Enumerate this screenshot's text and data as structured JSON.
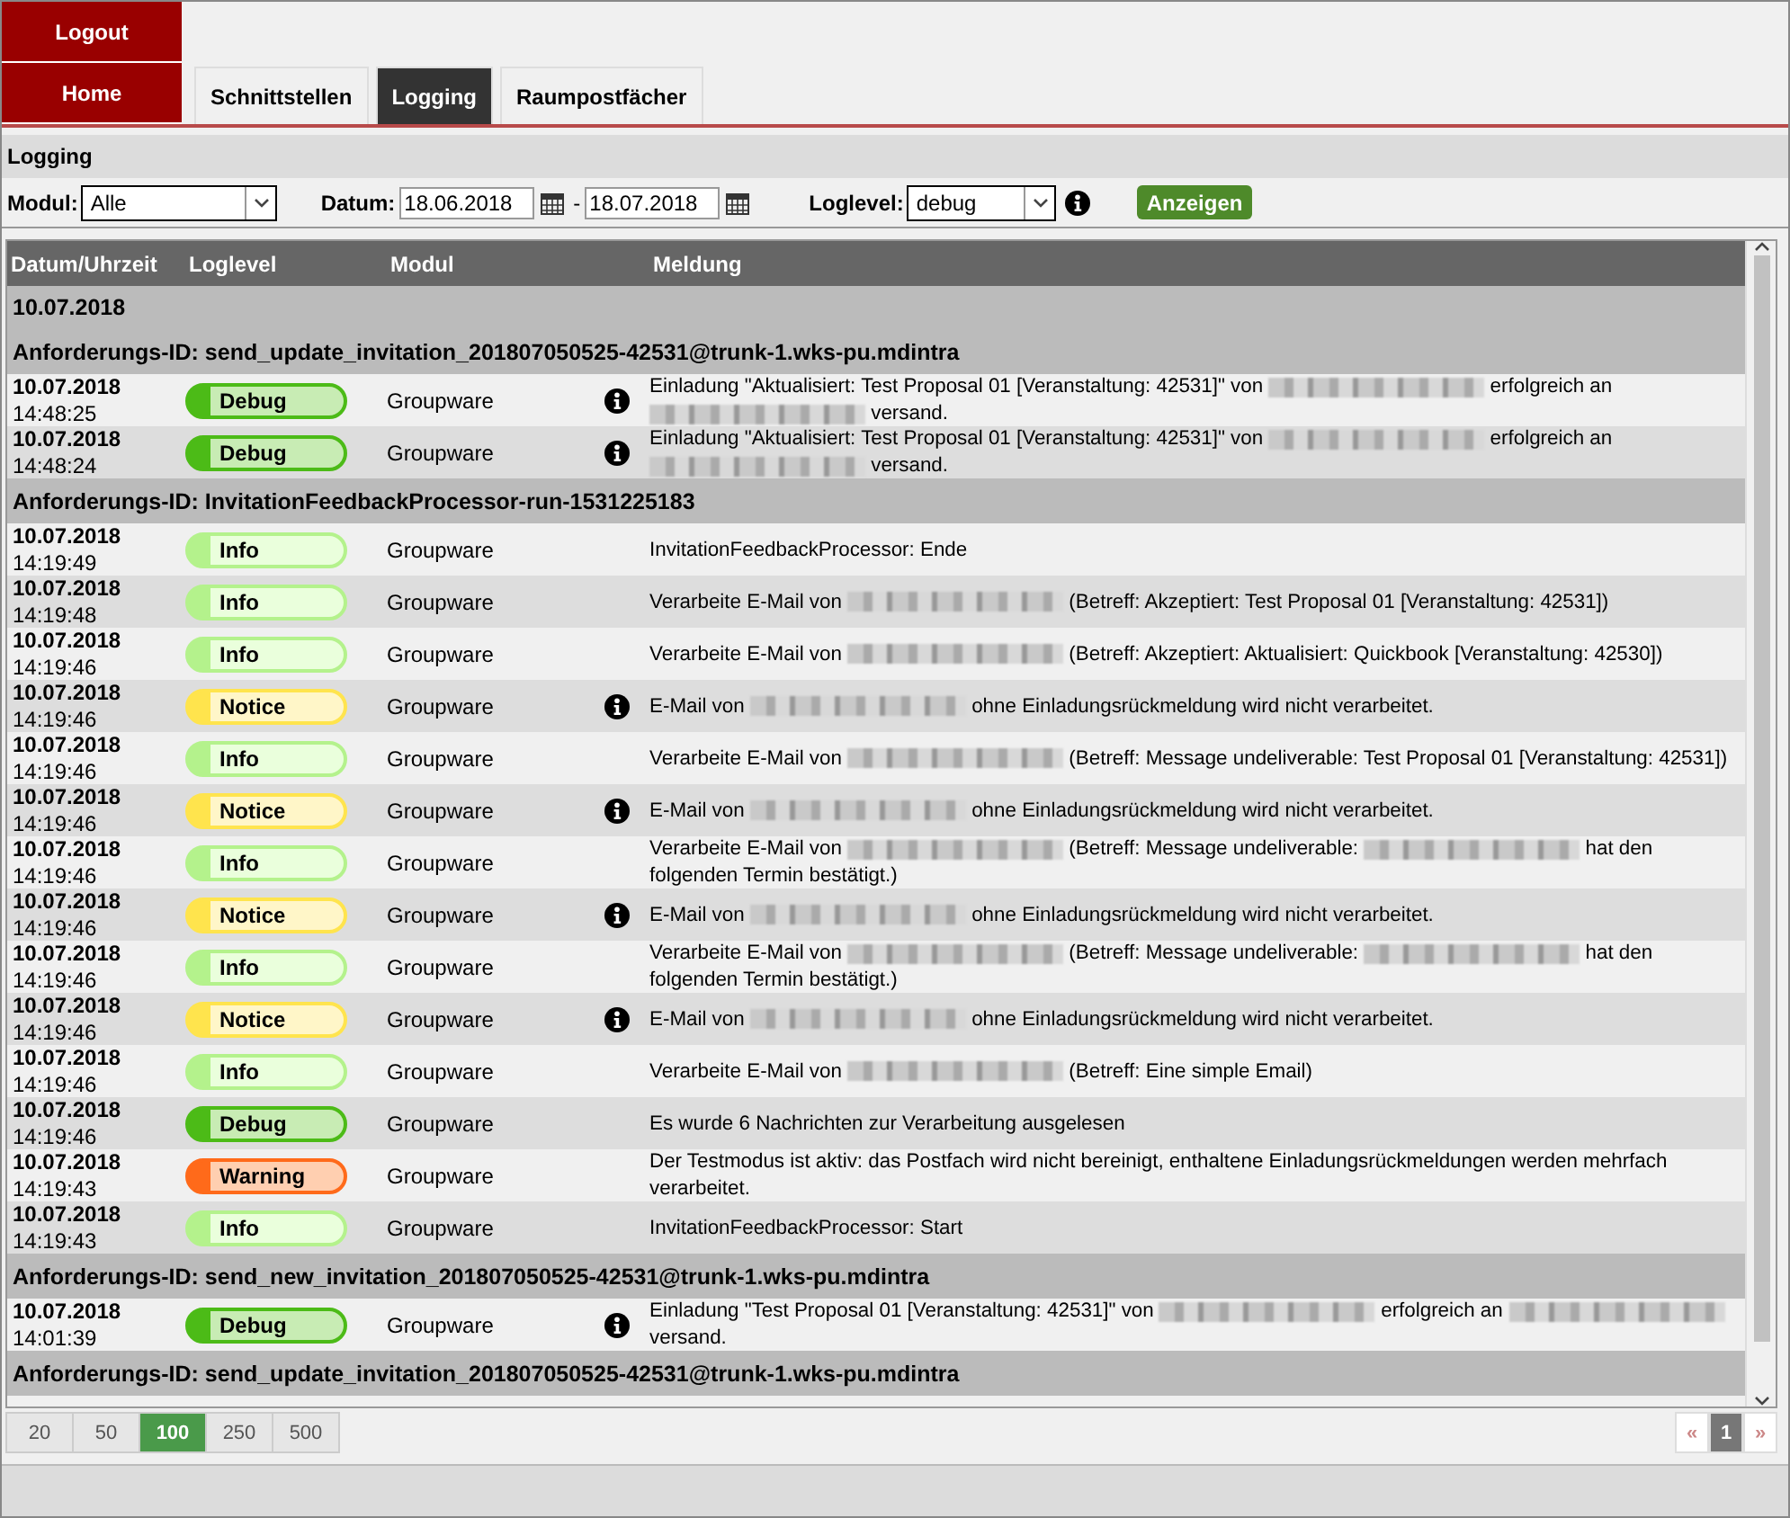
{
  "nav": {
    "logout": "Logout",
    "home": "Home",
    "tabs": [
      {
        "label": "Schnittstellen",
        "selected": false
      },
      {
        "label": "Logging",
        "selected": true
      },
      {
        "label": "Raumpostfächer",
        "selected": false
      }
    ]
  },
  "section_title": "Logging",
  "filter": {
    "module_label": "Modul:",
    "module_value": "Alle",
    "date_label": "Datum:",
    "date_from": "18.06.2018",
    "date_sep": "-",
    "date_to": "18.07.2018",
    "level_label": "Loglevel:",
    "level_value": "debug",
    "submit": "Anzeigen"
  },
  "table": {
    "columns": [
      "Datum/Uhrzeit",
      "Loglevel",
      "Modul",
      "Meldung"
    ],
    "rows": [
      {
        "kind": "date",
        "text": "10.07.2018"
      },
      {
        "kind": "request",
        "text": "Anforderungs-ID: send_update_invitation_201807050525-42531@trunk-1.wks-pu.mdintra"
      },
      {
        "kind": "log",
        "date": "10.07.2018",
        "time": "14:48:25",
        "level": {
          "kind": "debug",
          "label": "Debug"
        },
        "module": "Groupware",
        "info": true,
        "message": [
          {
            "kind": "text",
            "text": "Einladung \"Aktualisiert: Test Proposal 01 [Veranstaltung: 42531]\" von "
          },
          {
            "kind": "redacted"
          },
          {
            "kind": "text",
            "text": " erfolgreich an "
          },
          {
            "kind": "redacted"
          },
          {
            "kind": "text",
            "text": " versand."
          }
        ]
      },
      {
        "kind": "log",
        "date": "10.07.2018",
        "time": "14:48:24",
        "level": {
          "kind": "debug",
          "label": "Debug"
        },
        "module": "Groupware",
        "info": true,
        "message": [
          {
            "kind": "text",
            "text": "Einladung \"Aktualisiert: Test Proposal 01 [Veranstaltung: 42531]\" von "
          },
          {
            "kind": "redacted"
          },
          {
            "kind": "text",
            "text": " erfolgreich an "
          },
          {
            "kind": "redacted"
          },
          {
            "kind": "text",
            "text": " versand."
          }
        ]
      },
      {
        "kind": "request",
        "text": "Anforderungs-ID: InvitationFeedbackProcessor-run-1531225183"
      },
      {
        "kind": "log",
        "date": "10.07.2018",
        "time": "14:19:49",
        "level": {
          "kind": "info",
          "label": "Info"
        },
        "module": "Groupware",
        "info": false,
        "message": [
          {
            "kind": "text",
            "text": "InvitationFeedbackProcessor: Ende"
          }
        ]
      },
      {
        "kind": "log",
        "date": "10.07.2018",
        "time": "14:19:48",
        "level": {
          "kind": "info",
          "label": "Info"
        },
        "module": "Groupware",
        "info": false,
        "message": [
          {
            "kind": "text",
            "text": "Verarbeite E-Mail von "
          },
          {
            "kind": "redacted"
          },
          {
            "kind": "text",
            "text": " (Betreff: Akzeptiert: Test Proposal 01 [Veranstaltung: 42531])"
          }
        ]
      },
      {
        "kind": "log",
        "date": "10.07.2018",
        "time": "14:19:46",
        "level": {
          "kind": "info",
          "label": "Info"
        },
        "module": "Groupware",
        "info": false,
        "message": [
          {
            "kind": "text",
            "text": "Verarbeite E-Mail von "
          },
          {
            "kind": "redacted"
          },
          {
            "kind": "text",
            "text": " (Betreff: Akzeptiert: Aktualisiert: Quickbook [Veranstaltung: 42530])"
          }
        ]
      },
      {
        "kind": "log",
        "date": "10.07.2018",
        "time": "14:19:46",
        "level": {
          "kind": "notice",
          "label": "Notice"
        },
        "module": "Groupware",
        "info": true,
        "message": [
          {
            "kind": "text",
            "text": "E-Mail von "
          },
          {
            "kind": "redacted"
          },
          {
            "kind": "text",
            "text": " ohne Einladungsrückmeldung wird nicht verarbeitet."
          }
        ]
      },
      {
        "kind": "log",
        "date": "10.07.2018",
        "time": "14:19:46",
        "level": {
          "kind": "info",
          "label": "Info"
        },
        "module": "Groupware",
        "info": false,
        "message": [
          {
            "kind": "text",
            "text": "Verarbeite E-Mail von "
          },
          {
            "kind": "redacted"
          },
          {
            "kind": "text",
            "text": " (Betreff: Message undeliverable: Test Proposal 01 [Veranstaltung: 42531])"
          }
        ]
      },
      {
        "kind": "log",
        "date": "10.07.2018",
        "time": "14:19:46",
        "level": {
          "kind": "notice",
          "label": "Notice"
        },
        "module": "Groupware",
        "info": true,
        "message": [
          {
            "kind": "text",
            "text": "E-Mail von "
          },
          {
            "kind": "redacted"
          },
          {
            "kind": "text",
            "text": " ohne Einladungsrückmeldung wird nicht verarbeitet."
          }
        ]
      },
      {
        "kind": "log",
        "date": "10.07.2018",
        "time": "14:19:46",
        "level": {
          "kind": "info",
          "label": "Info"
        },
        "module": "Groupware",
        "info": false,
        "message": [
          {
            "kind": "text",
            "text": "Verarbeite E-Mail von "
          },
          {
            "kind": "redacted"
          },
          {
            "kind": "text",
            "text": " (Betreff: Message undeliverable: "
          },
          {
            "kind": "redacted"
          },
          {
            "kind": "text",
            "text": " hat den folgenden Termin bestätigt.)"
          }
        ]
      },
      {
        "kind": "log",
        "date": "10.07.2018",
        "time": "14:19:46",
        "level": {
          "kind": "notice",
          "label": "Notice"
        },
        "module": "Groupware",
        "info": true,
        "message": [
          {
            "kind": "text",
            "text": "E-Mail von "
          },
          {
            "kind": "redacted"
          },
          {
            "kind": "text",
            "text": " ohne Einladungsrückmeldung wird nicht verarbeitet."
          }
        ]
      },
      {
        "kind": "log",
        "date": "10.07.2018",
        "time": "14:19:46",
        "level": {
          "kind": "info",
          "label": "Info"
        },
        "module": "Groupware",
        "info": false,
        "message": [
          {
            "kind": "text",
            "text": "Verarbeite E-Mail von "
          },
          {
            "kind": "redacted"
          },
          {
            "kind": "text",
            "text": " (Betreff: Message undeliverable: "
          },
          {
            "kind": "redacted"
          },
          {
            "kind": "text",
            "text": " hat den folgenden Termin bestätigt.)"
          }
        ]
      },
      {
        "kind": "log",
        "date": "10.07.2018",
        "time": "14:19:46",
        "level": {
          "kind": "notice",
          "label": "Notice"
        },
        "module": "Groupware",
        "info": true,
        "message": [
          {
            "kind": "text",
            "text": "E-Mail von "
          },
          {
            "kind": "redacted"
          },
          {
            "kind": "text",
            "text": " ohne Einladungsrückmeldung wird nicht verarbeitet."
          }
        ]
      },
      {
        "kind": "log",
        "date": "10.07.2018",
        "time": "14:19:46",
        "level": {
          "kind": "info",
          "label": "Info"
        },
        "module": "Groupware",
        "info": false,
        "message": [
          {
            "kind": "text",
            "text": "Verarbeite E-Mail von "
          },
          {
            "kind": "redacted"
          },
          {
            "kind": "text",
            "text": " (Betreff: Eine simple Email)"
          }
        ]
      },
      {
        "kind": "log",
        "date": "10.07.2018",
        "time": "14:19:46",
        "level": {
          "kind": "debug",
          "label": "Debug"
        },
        "module": "Groupware",
        "info": false,
        "message": [
          {
            "kind": "text",
            "text": "Es wurde 6 Nachrichten zur Verarbeitung ausgelesen"
          }
        ]
      },
      {
        "kind": "log",
        "date": "10.07.2018",
        "time": "14:19:43",
        "level": {
          "kind": "warning",
          "label": "Warning"
        },
        "module": "Groupware",
        "info": false,
        "message": [
          {
            "kind": "text",
            "text": "Der Testmodus ist aktiv: das Postfach wird nicht bereinigt, enthaltene Einladungsrückmeldungen werden mehrfach verarbeitet."
          }
        ]
      },
      {
        "kind": "log",
        "date": "10.07.2018",
        "time": "14:19:43",
        "level": {
          "kind": "info",
          "label": "Info"
        },
        "module": "Groupware",
        "info": false,
        "message": [
          {
            "kind": "text",
            "text": "InvitationFeedbackProcessor: Start"
          }
        ]
      },
      {
        "kind": "request",
        "text": "Anforderungs-ID: send_new_invitation_201807050525-42531@trunk-1.wks-pu.mdintra"
      },
      {
        "kind": "log",
        "date": "10.07.2018",
        "time": "14:01:39",
        "level": {
          "kind": "debug",
          "label": "Debug"
        },
        "module": "Groupware",
        "info": true,
        "message": [
          {
            "kind": "text",
            "text": "Einladung \"Test Proposal 01 [Veranstaltung: 42531]\" von "
          },
          {
            "kind": "redacted"
          },
          {
            "kind": "text",
            "text": " erfolgreich an "
          },
          {
            "kind": "redacted"
          },
          {
            "kind": "text",
            "text": " versand."
          }
        ]
      },
      {
        "kind": "request",
        "text": "Anforderungs-ID: send_update_invitation_201807050525-42531@trunk-1.wks-pu.mdintra"
      }
    ]
  },
  "page_sizes": [
    {
      "label": "20",
      "selected": false
    },
    {
      "label": "50",
      "selected": false
    },
    {
      "label": "100",
      "selected": true
    },
    {
      "label": "250",
      "selected": false
    },
    {
      "label": "500",
      "selected": false
    }
  ],
  "pager": {
    "prev": "«",
    "pages": [
      {
        "label": "1",
        "selected": true
      }
    ],
    "next": "»"
  }
}
